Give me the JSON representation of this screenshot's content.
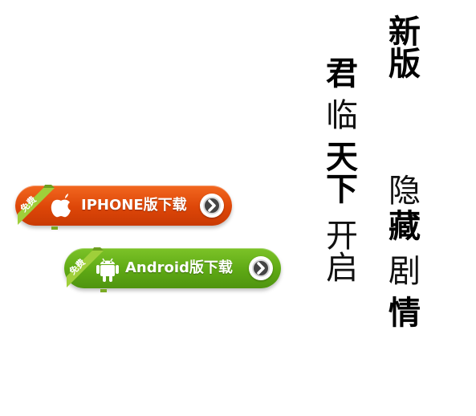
{
  "buttons": {
    "iphone": {
      "label": "IPHONE版下载",
      "badge": "免费",
      "icon": "apple-icon",
      "color": "#dd4608"
    },
    "android": {
      "label": "Android版下载",
      "badge": "免费",
      "icon": "android-icon",
      "color": "#5ea814"
    }
  },
  "slogans": {
    "col1": {
      "a": "新版",
      "b": "隐",
      "c": "藏",
      "d": "剧",
      "e": "情"
    },
    "col2": {
      "a": "君",
      "b": "临",
      "c": "天下",
      "d": "开启"
    }
  }
}
